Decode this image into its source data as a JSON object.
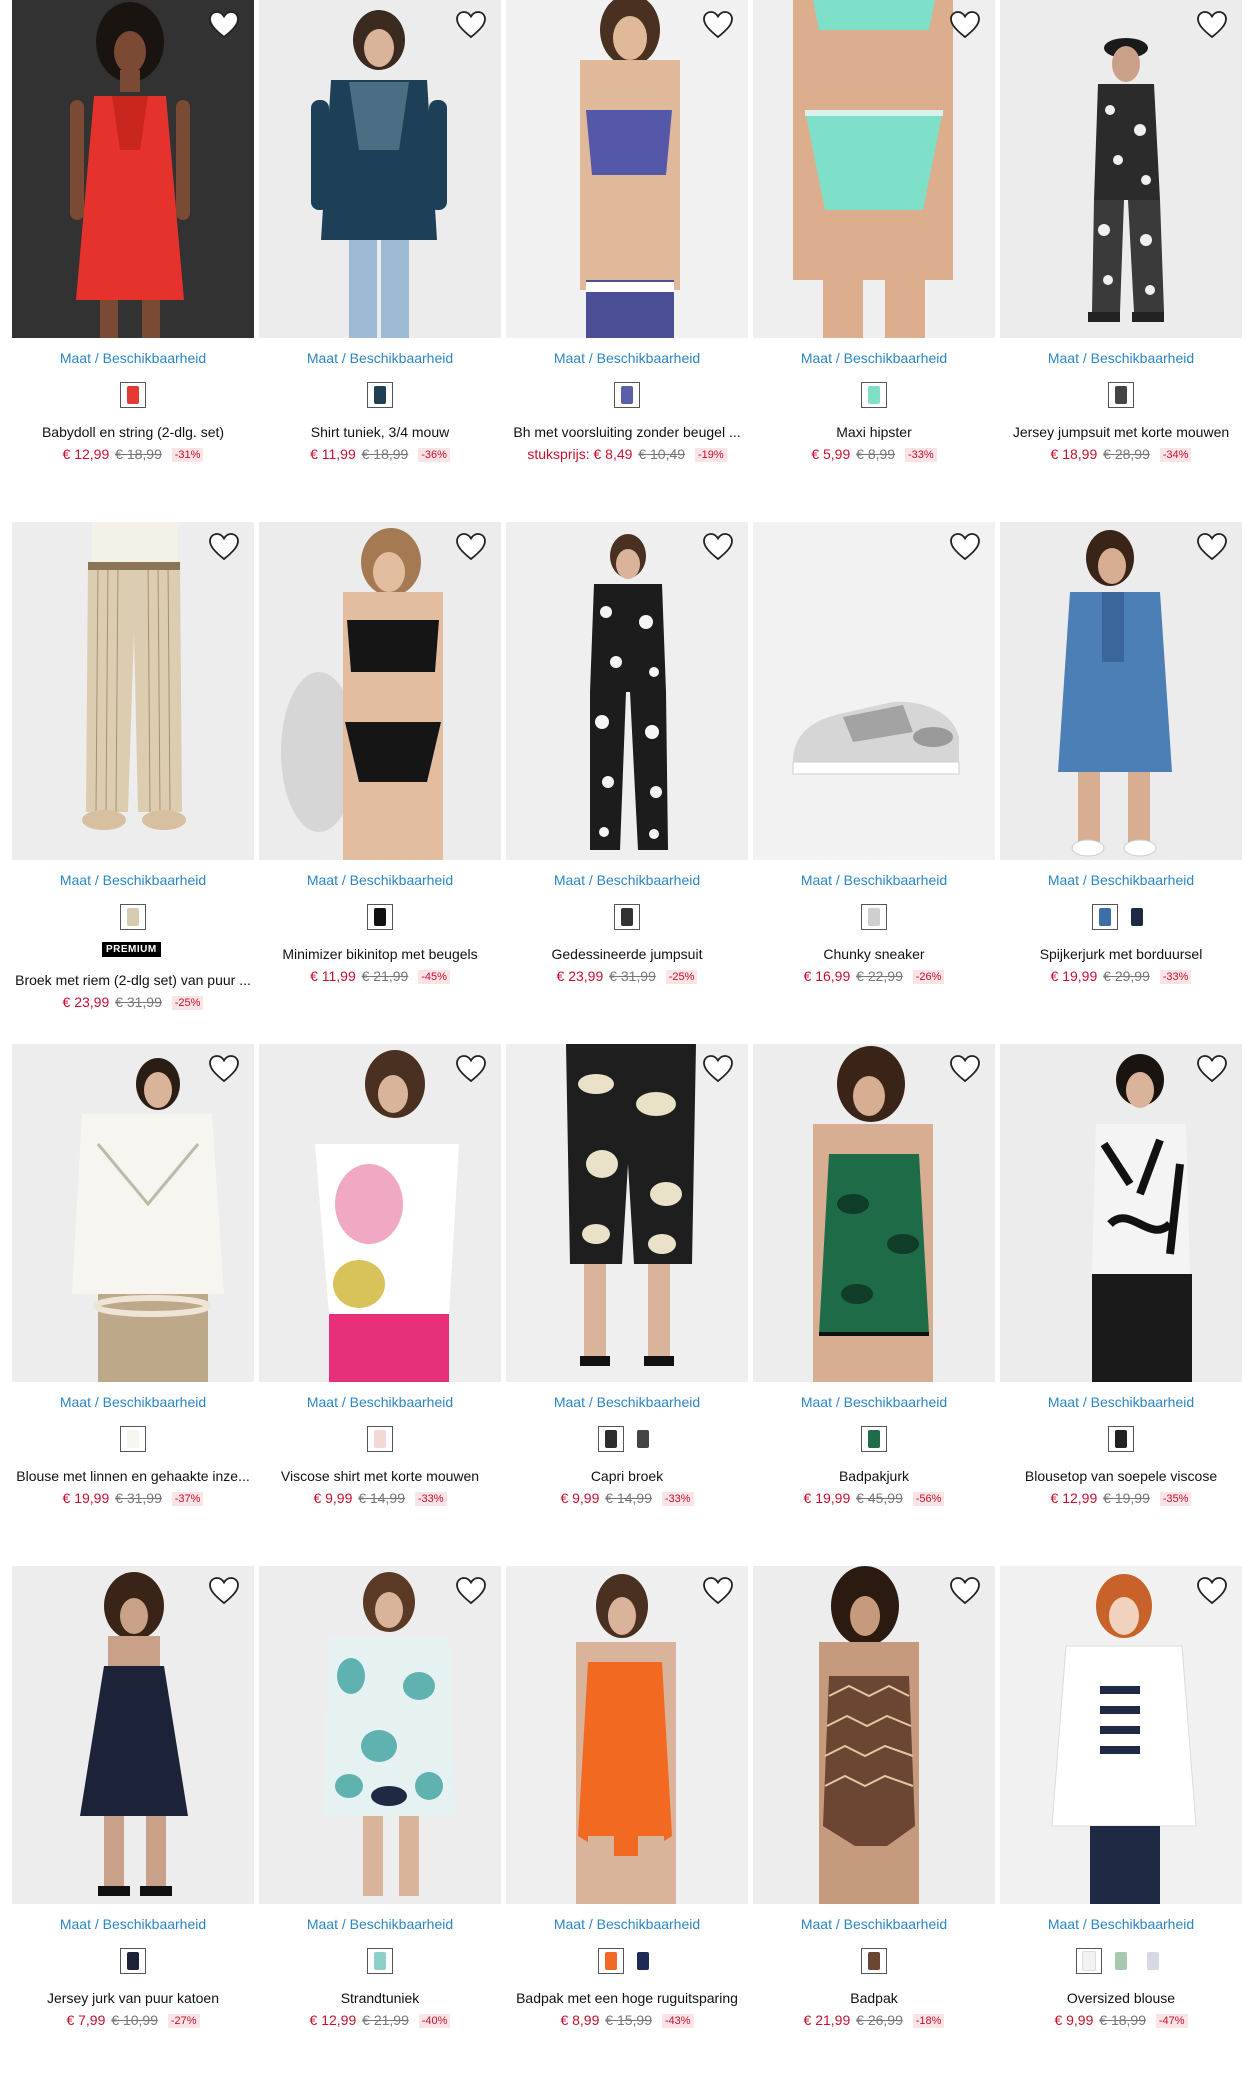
{
  "size_link_label": "Maat / Beschikbaarheid",
  "colors": {
    "link": "#2b86c5",
    "price": "#c8102e",
    "discount_bg": "#fbe3e6"
  },
  "products": [
    {
      "name": "Babydoll en string (2-dlg. set)",
      "price": "€ 12,99",
      "old_price": "€ 18,99",
      "discount": "-31%",
      "swatches": [
        "#e53935"
      ]
    },
    {
      "name": "Shirt tuniek, 3/4 mouw",
      "price": "€ 11,99",
      "old_price": "€ 18,99",
      "discount": "-36%",
      "swatches": [
        "#1f3f55"
      ]
    },
    {
      "name": "Bh met voorsluiting zonder beugel ...",
      "unit_label": "stuksprijs:",
      "price": "€ 8,49",
      "old_price": "€ 10,49",
      "discount": "-19%",
      "swatches": [
        "#5b5fa8"
      ]
    },
    {
      "name": "Maxi hipster",
      "price": "€ 5,99",
      "old_price": "€ 8,99",
      "discount": "-33%",
      "swatches": [
        "#7fe0c7"
      ]
    },
    {
      "name": "Jersey jumpsuit met korte mouwen",
      "price": "€ 18,99",
      "old_price": "€ 28,99",
      "discount": "-34%",
      "swatches": [
        "#444444"
      ]
    },
    {
      "name": "Broek met riem (2-dlg set) van puur ...",
      "premium": "PREMIUM",
      "price": "€ 23,99",
      "old_price": "€ 31,99",
      "discount": "-25%",
      "swatches": [
        "#d8ccb0"
      ]
    },
    {
      "name": "Minimizer bikinitop met beugels",
      "price": "€ 11,99",
      "old_price": "€ 21,99",
      "discount": "-45%",
      "swatches": [
        "#111111"
      ]
    },
    {
      "name": "Gedessineerde jumpsuit",
      "price": "€ 23,99",
      "old_price": "€ 31,99",
      "discount": "-25%",
      "swatches": [
        "#333333"
      ]
    },
    {
      "name": "Chunky sneaker",
      "price": "€ 16,99",
      "old_price": "€ 22,99",
      "discount": "-26%",
      "swatches": [
        "#cfcfcf"
      ]
    },
    {
      "name": "Spijkerjurk met borduursel",
      "price": "€ 19,99",
      "old_price": "€ 29,99",
      "discount": "-33%",
      "swatches": [
        "#3c6ea8",
        "#1e2a44"
      ]
    },
    {
      "name": "Blouse met linnen en gehaakte inze...",
      "price": "€ 19,99",
      "old_price": "€ 31,99",
      "discount": "-37%",
      "swatches": [
        "#f7f5ef"
      ]
    },
    {
      "name": "Viscose shirt met korte mouwen",
      "price": "€ 9,99",
      "old_price": "€ 14,99",
      "discount": "-33%",
      "swatches": [
        "#f3d9d6"
      ]
    },
    {
      "name": "Capri broek",
      "price": "€ 9,99",
      "old_price": "€ 14,99",
      "discount": "-33%",
      "swatches": [
        "#2d2d2d",
        "#444444"
      ]
    },
    {
      "name": "Badpakjurk",
      "price": "€ 19,99",
      "old_price": "€ 45,99",
      "discount": "-56%",
      "swatches": [
        "#1f6b4a"
      ]
    },
    {
      "name": "Blousetop van soepele viscose",
      "price": "€ 12,99",
      "old_price": "€ 19,99",
      "discount": "-35%",
      "swatches": [
        "#222222"
      ]
    },
    {
      "name": "Jersey jurk van puur katoen",
      "price": "€ 7,99",
      "old_price": "€ 10,99",
      "discount": "-27%",
      "swatches": [
        "#1c2338"
      ]
    },
    {
      "name": "Strandtuniek",
      "price": "€ 12,99",
      "old_price": "€ 21,99",
      "discount": "-40%",
      "swatches": [
        "#8fcfc9"
      ]
    },
    {
      "name": "Badpak met een hoge ruguitsparing",
      "price": "€ 8,99",
      "old_price": "€ 15,99",
      "discount": "-43%",
      "swatches": [
        "#f06a25",
        "#1c2a55"
      ]
    },
    {
      "name": "Badpak",
      "price": "€ 21,99",
      "old_price": "€ 26,99",
      "discount": "-18%",
      "swatches": [
        "#6b4632"
      ]
    },
    {
      "name": "Oversized blouse",
      "price": "€ 9,99",
      "old_price": "€ 18,99",
      "discount": "-47%",
      "swatches": [
        "#f2f2f2",
        "#a8c8b0",
        "#d6d8e6"
      ]
    }
  ]
}
